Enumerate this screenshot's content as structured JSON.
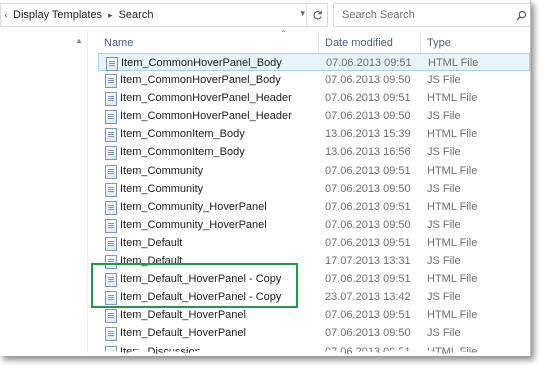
{
  "breadcrumb": {
    "items": [
      "Display Templates",
      "Search"
    ]
  },
  "search": {
    "placeholder": "Search Search"
  },
  "columns": {
    "name": "Name",
    "date": "Date modified",
    "type": "Type"
  },
  "files": [
    {
      "name": "Item_CommonHoverPanel_Body",
      "date": "07.06.2013 09:51",
      "type": "HTML File"
    },
    {
      "name": "Item_CommonHoverPanel_Body",
      "date": "07.06.2013 09:50",
      "type": "JS File"
    },
    {
      "name": "Item_CommonHoverPanel_Header",
      "date": "07.06.2013 09:51",
      "type": "HTML File"
    },
    {
      "name": "Item_CommonHoverPanel_Header",
      "date": "07.06.2013 09:50",
      "type": "JS File"
    },
    {
      "name": "Item_CommonItem_Body",
      "date": "13.06.2013 15:39",
      "type": "HTML File"
    },
    {
      "name": "Item_CommonItem_Body",
      "date": "13.06.2013 16:56",
      "type": "JS File"
    },
    {
      "name": "Item_Community",
      "date": "07.06.2013 09:51",
      "type": "HTML File"
    },
    {
      "name": "Item_Community",
      "date": "07.06.2013 09:50",
      "type": "JS File"
    },
    {
      "name": "Item_Community_HoverPanel",
      "date": "07.06.2013 09:51",
      "type": "HTML File"
    },
    {
      "name": "Item_Community_HoverPanel",
      "date": "07.06.2013 09:50",
      "type": "JS File"
    },
    {
      "name": "Item_Default",
      "date": "07.06.2013 09:51",
      "type": "HTML File"
    },
    {
      "name": "Item_Default",
      "date": "17.07.2013 13:31",
      "type": "JS File"
    },
    {
      "name": "Item_Default_HoverPanel - Copy",
      "date": "07.06.2013 09:51",
      "type": "HTML File"
    },
    {
      "name": "Item_Default_HoverPanel - Copy",
      "date": "23.07.2013 13:42",
      "type": "JS File"
    },
    {
      "name": "Item_Default_HoverPanel",
      "date": "07.06.2013 09:51",
      "type": "HTML File"
    },
    {
      "name": "Item_Default_HoverPanel",
      "date": "07.06.2013 09:50",
      "type": "JS File"
    },
    {
      "name": "Item_Discussion",
      "date": "07.06.2013 09:51",
      "type": "HTML File"
    }
  ],
  "selected_index": 0,
  "colors": {
    "selection_bg": "#e5f3fb",
    "selection_border": "#a5d3f0",
    "highlight": "#1f9a4b",
    "header_text": "#4c607a"
  },
  "icons": {
    "back": "chevron-left-icon",
    "separator": "chevron-right-icon",
    "refresh": "refresh-icon",
    "search": "search-icon",
    "file": "file-icon",
    "sort": "sort-up-icon"
  }
}
